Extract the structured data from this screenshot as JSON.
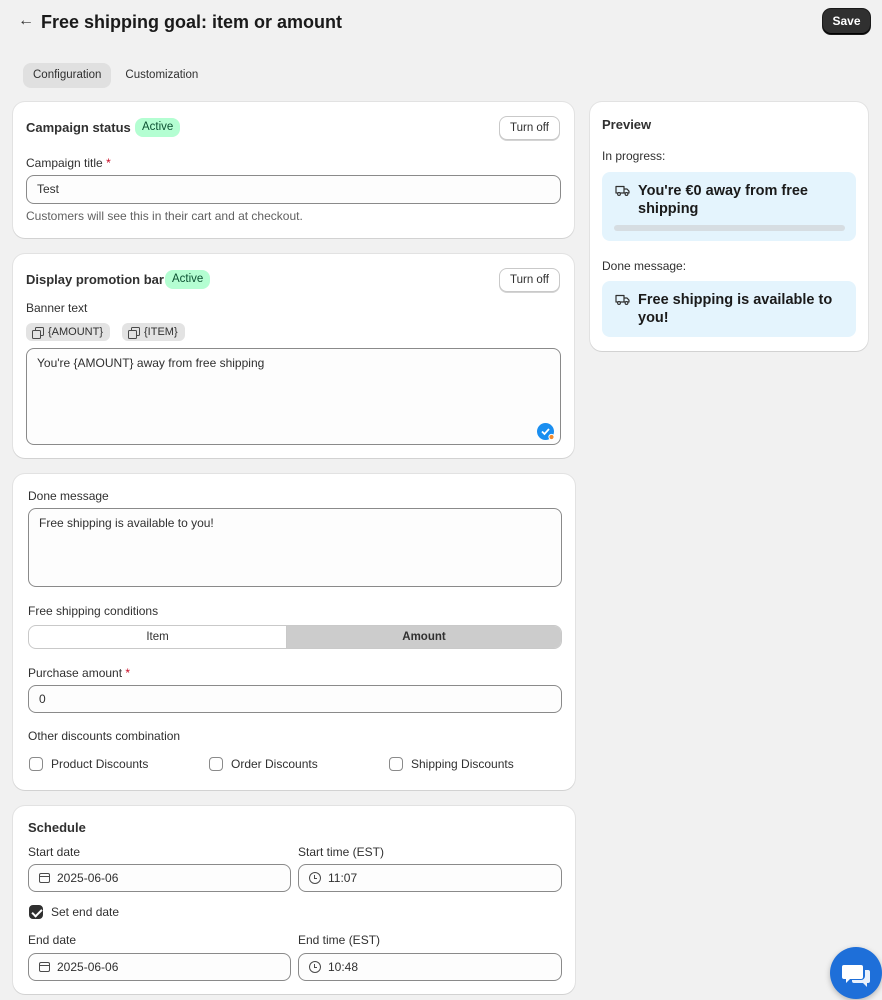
{
  "header": {
    "back_icon": "arrow-left-icon",
    "title": "Free shipping goal: item or amount",
    "save_label": "Save"
  },
  "tabs": [
    {
      "label": "Configuration",
      "active": true
    },
    {
      "label": "Customization",
      "active": false
    }
  ],
  "campaign_status": {
    "title": "Campaign status",
    "badge": "Active",
    "button": "Turn off",
    "field_label": "Campaign title",
    "required_mark": "*",
    "field_value": "Test",
    "help_text": "Customers will see this in their cart and at checkout."
  },
  "promotion_bar": {
    "title": "Display promotion bar",
    "badge": "Active",
    "button": "Turn off",
    "field_label": "Banner text",
    "chips": [
      "{AMOUNT}",
      "{ITEM}"
    ],
    "banner_value": "You're {AMOUNT} away from free shipping"
  },
  "conditions": {
    "done_label": "Done message",
    "done_value": "Free shipping is available to you!",
    "conditions_label": "Free shipping conditions",
    "options": [
      "Item",
      "Amount"
    ],
    "selected": "Amount",
    "purchase_label": "Purchase amount",
    "required_mark": "*",
    "purchase_value": "0",
    "combination_label": "Other discounts combination",
    "discounts": [
      {
        "label": "Product Discounts",
        "checked": false
      },
      {
        "label": "Order Discounts",
        "checked": false
      },
      {
        "label": "Shipping Discounts",
        "checked": false
      }
    ]
  },
  "schedule": {
    "title": "Schedule",
    "start_date_label": "Start date",
    "start_date": "2025-06-06",
    "start_time_label": "Start time (EST)",
    "start_time": "11:07",
    "end_toggle_label": "Set end date",
    "end_toggle_checked": true,
    "end_date_label": "End date",
    "end_date": "2025-06-06",
    "end_time_label": "End time (EST)",
    "end_time": "10:48"
  },
  "preview": {
    "title": "Preview",
    "in_progress_label": "In progress:",
    "in_progress_text": "You're €0 away from free shipping",
    "progress": 0,
    "done_label": "Done message:",
    "done_text": "Free shipping is available to you!",
    "icon": "truck-icon"
  },
  "colors": {
    "active_badge_bg": "#b4fed2",
    "preview_bg": "#e4f4fd",
    "chat_button": "#1e6fd9"
  }
}
